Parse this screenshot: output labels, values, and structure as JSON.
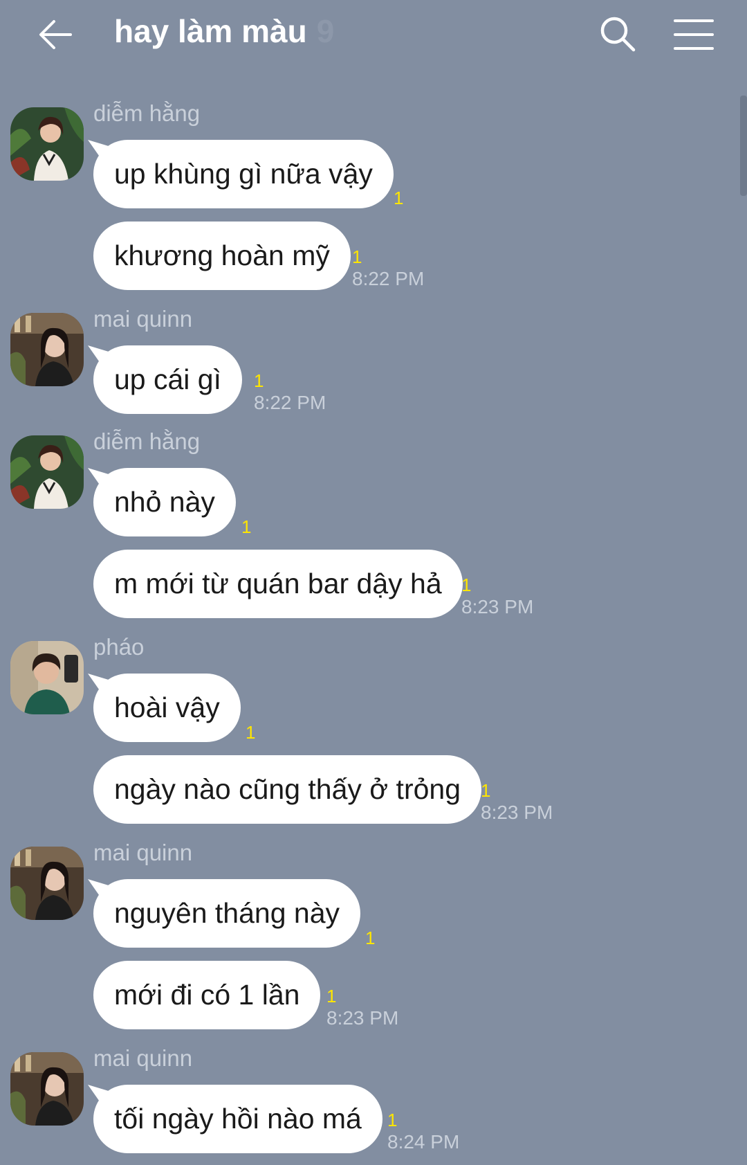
{
  "header": {
    "title": "hay làm màu",
    "member_count": "9",
    "back_icon": "arrow-left-icon",
    "search_icon": "search-icon",
    "menu_icon": "hamburger-menu-icon"
  },
  "colors": {
    "background": "#828ea1",
    "bubble": "#ffffff",
    "read_count": "#ffe600",
    "secondary_text": "#c9d0da"
  },
  "messages": [
    {
      "sender": "diễm hằng",
      "text": "up khùng gì nữa vậy",
      "read": "1",
      "time": ""
    },
    {
      "sender": "",
      "text": "khương hoàn mỹ",
      "read": "1",
      "time": "8:22 PM"
    },
    {
      "sender": "mai quinn",
      "text": "up cái gì",
      "read": "1",
      "time": "8:22 PM"
    },
    {
      "sender": "diễm hằng",
      "text": "nhỏ này",
      "read": "1",
      "time": ""
    },
    {
      "sender": "",
      "text": "m mới từ quán bar dậy hả",
      "read": "1",
      "time": "8:23 PM"
    },
    {
      "sender": "pháo",
      "text": "hoài vậy",
      "read": "1",
      "time": ""
    },
    {
      "sender": "",
      "text": "ngày nào cũng thấy ở trỏng",
      "read": "1",
      "time": "8:23 PM"
    },
    {
      "sender": "mai quinn",
      "text": "nguyên tháng này",
      "read": "1",
      "time": ""
    },
    {
      "sender": "",
      "text": "mới đi có 1 lần",
      "read": "1",
      "time": "8:23 PM"
    },
    {
      "sender": "mai quinn",
      "text": "tối ngày hồi nào má",
      "read": "1",
      "time": "8:24 PM"
    }
  ]
}
